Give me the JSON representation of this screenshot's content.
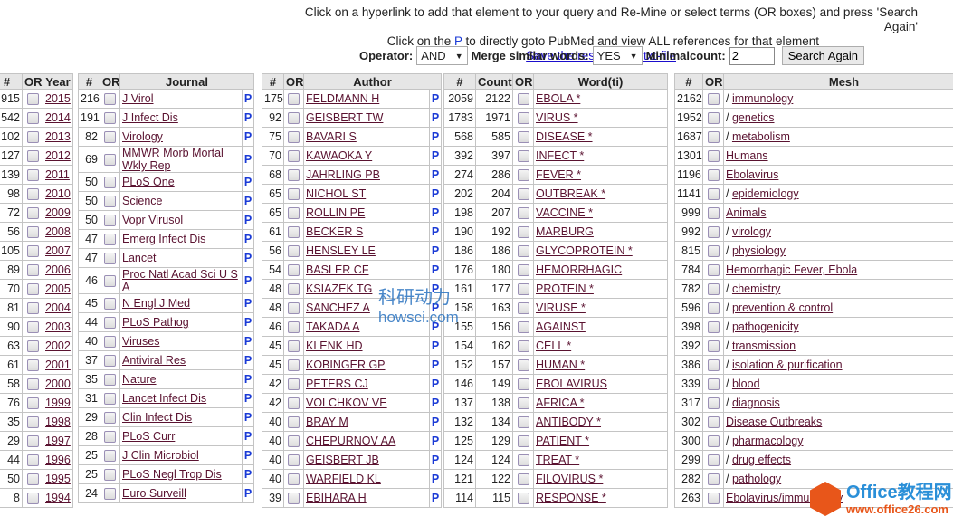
{
  "header": {
    "line1": "Click on a hyperlink to add that element to your query and Re-Mine or select terms (OR boxes) and press 'Search Again'",
    "line2_pre": "Click on the ",
    "line2_p": "P",
    "line2_post": " to directly goto PubMed and view ALL references for that element",
    "save_link": "Save the results as a txt-file"
  },
  "controls": {
    "operator_label": "Operator:",
    "operator_value": "AND",
    "merge_label": "Merge similar words:",
    "merge_value": "YES",
    "mincount_label": "Minimalcount:",
    "mincount_value": "2",
    "search_button": "Search Again"
  },
  "p_label": "P",
  "year_table": {
    "headers": [
      "#",
      "OR",
      "Year"
    ],
    "rows": [
      [
        "915",
        "2015"
      ],
      [
        "542",
        "2014"
      ],
      [
        "102",
        "2013"
      ],
      [
        "127",
        "2012"
      ],
      [
        "139",
        "2011"
      ],
      [
        "98",
        "2010"
      ],
      [
        "72",
        "2009"
      ],
      [
        "56",
        "2008"
      ],
      [
        "105",
        "2007"
      ],
      [
        "89",
        "2006"
      ],
      [
        "70",
        "2005"
      ],
      [
        "81",
        "2004"
      ],
      [
        "90",
        "2003"
      ],
      [
        "63",
        "2002"
      ],
      [
        "61",
        "2001"
      ],
      [
        "58",
        "2000"
      ],
      [
        "76",
        "1999"
      ],
      [
        "35",
        "1998"
      ],
      [
        "29",
        "1997"
      ],
      [
        "44",
        "1996"
      ],
      [
        "50",
        "1995"
      ],
      [
        "8",
        "1994"
      ]
    ]
  },
  "journal_table": {
    "headers": [
      "#",
      "OR",
      "Journal"
    ],
    "rows": [
      [
        "216",
        "J Virol"
      ],
      [
        "191",
        "J Infect Dis"
      ],
      [
        "82",
        "Virology"
      ],
      [
        "69",
        "MMWR Morb Mortal Wkly Rep"
      ],
      [
        "50",
        "PLoS One"
      ],
      [
        "50",
        "Science"
      ],
      [
        "50",
        "Vopr Virusol"
      ],
      [
        "47",
        "Emerg Infect Dis"
      ],
      [
        "47",
        "Lancet"
      ],
      [
        "46",
        "Proc Natl Acad Sci U S A"
      ],
      [
        "45",
        "N Engl J Med"
      ],
      [
        "44",
        "PLoS Pathog"
      ],
      [
        "40",
        "Viruses"
      ],
      [
        "37",
        "Antiviral Res"
      ],
      [
        "35",
        "Nature"
      ],
      [
        "31",
        "Lancet Infect Dis"
      ],
      [
        "29",
        "Clin Infect Dis"
      ],
      [
        "28",
        "PLoS Curr"
      ],
      [
        "25",
        "J Clin Microbiol"
      ],
      [
        "25",
        "PLoS Negl Trop Dis"
      ],
      [
        "24",
        "Euro Surveill"
      ]
    ]
  },
  "author_table": {
    "headers": [
      "#",
      "OR",
      "Author"
    ],
    "rows": [
      [
        "175",
        "FELDMANN H"
      ],
      [
        "92",
        "GEISBERT TW"
      ],
      [
        "75",
        "BAVARI S"
      ],
      [
        "70",
        "KAWAOKA Y"
      ],
      [
        "68",
        "JAHRLING PB"
      ],
      [
        "65",
        "NICHOL ST"
      ],
      [
        "65",
        "ROLLIN PE"
      ],
      [
        "61",
        "BECKER S"
      ],
      [
        "56",
        "HENSLEY LE"
      ],
      [
        "54",
        "BASLER CF"
      ],
      [
        "48",
        "KSIAZEK TG"
      ],
      [
        "48",
        "SANCHEZ A"
      ],
      [
        "46",
        "TAKADA A"
      ],
      [
        "45",
        "KLENK HD"
      ],
      [
        "45",
        "KOBINGER GP"
      ],
      [
        "42",
        "PETERS CJ"
      ],
      [
        "42",
        "VOLCHKOV VE"
      ],
      [
        "40",
        "BRAY M"
      ],
      [
        "40",
        "CHEPURNOV AA"
      ],
      [
        "40",
        "GEISBERT JB"
      ],
      [
        "40",
        "WARFIELD KL"
      ],
      [
        "39",
        "EBIHARA H"
      ]
    ]
  },
  "word_table": {
    "headers": [
      "#",
      "Count",
      "OR",
      "Word(ti)"
    ],
    "rows": [
      [
        "2059",
        "2122",
        "EBOLA *"
      ],
      [
        "1783",
        "1971",
        "VIRUS *"
      ],
      [
        "568",
        "585",
        "DISEASE *"
      ],
      [
        "392",
        "397",
        "INFECT *"
      ],
      [
        "274",
        "286",
        "FEVER *"
      ],
      [
        "202",
        "204",
        "OUTBREAK *"
      ],
      [
        "198",
        "207",
        "VACCINE *"
      ],
      [
        "190",
        "192",
        "MARBURG"
      ],
      [
        "186",
        "186",
        "GLYCOPROTEIN *"
      ],
      [
        "176",
        "180",
        "HEMORRHAGIC"
      ],
      [
        "161",
        "177",
        "PROTEIN *"
      ],
      [
        "158",
        "163",
        "VIRUSE *"
      ],
      [
        "155",
        "156",
        "AGAINST"
      ],
      [
        "154",
        "162",
        "CELL *"
      ],
      [
        "152",
        "157",
        "HUMAN *"
      ],
      [
        "146",
        "149",
        "EBOLAVIRUS"
      ],
      [
        "137",
        "138",
        "AFRICA *"
      ],
      [
        "132",
        "134",
        "ANTIBODY *"
      ],
      [
        "125",
        "129",
        "PATIENT *"
      ],
      [
        "124",
        "124",
        "TREAT *"
      ],
      [
        "121",
        "122",
        "FILOVIRUS *"
      ],
      [
        "114",
        "115",
        "RESPONSE *"
      ]
    ]
  },
  "mesh_table": {
    "headers": [
      "#",
      "OR",
      "Mesh"
    ],
    "rows": [
      [
        "2162",
        "/ ",
        "immunology"
      ],
      [
        "1952",
        "/ ",
        "genetics"
      ],
      [
        "1687",
        "/ ",
        "metabolism"
      ],
      [
        "1301",
        "",
        "Humans"
      ],
      [
        "1196",
        "",
        "Ebolavirus"
      ],
      [
        "1141",
        "/ ",
        "epidemiology"
      ],
      [
        "999",
        "",
        "Animals"
      ],
      [
        "992",
        "/ ",
        "virology"
      ],
      [
        "815",
        "/ ",
        "physiology"
      ],
      [
        "784",
        "",
        "Hemorrhagic Fever, Ebola"
      ],
      [
        "782",
        "/ ",
        "chemistry"
      ],
      [
        "596",
        "/ ",
        "prevention & control"
      ],
      [
        "398",
        "/ ",
        "pathogenicity"
      ],
      [
        "392",
        "/ ",
        "transmission"
      ],
      [
        "386",
        "/ ",
        "isolation & purification"
      ],
      [
        "339",
        "/ ",
        "blood"
      ],
      [
        "317",
        "/ ",
        "diagnosis"
      ],
      [
        "302",
        "",
        "Disease Outbreaks"
      ],
      [
        "300",
        "/ ",
        "pharmacology"
      ],
      [
        "299",
        "/ ",
        "drug effects"
      ],
      [
        "282",
        "/ ",
        "pathology"
      ],
      [
        "263",
        "",
        "Ebolavirus/immunology"
      ]
    ]
  },
  "watermarks": {
    "howsci_cn": "科研动力",
    "howsci_url": "howsci.com",
    "office_name": "Office教程网",
    "office_url": "www.office26.com"
  },
  "colors": {
    "link": "#5a1230",
    "p_link": "#1a3ad6",
    "header_bg": "#e6e6e6",
    "border": "#c4c4c4"
  }
}
